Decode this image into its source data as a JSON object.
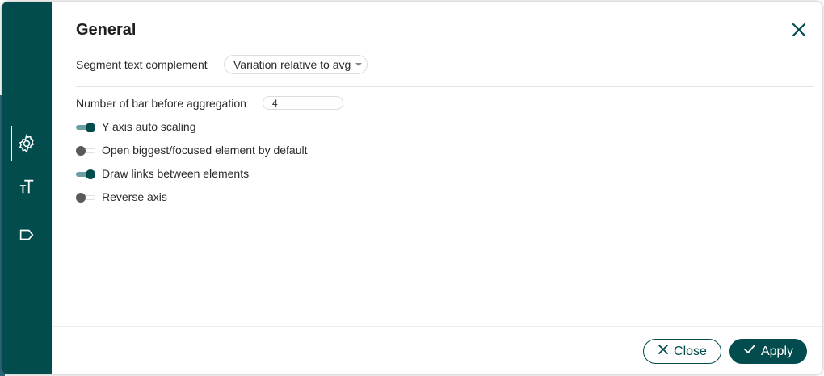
{
  "dialog": {
    "title": "General"
  },
  "sidebar": {
    "items": [
      {
        "icon": "gear-icon",
        "active": true
      },
      {
        "icon": "text-size-icon",
        "active": false
      },
      {
        "icon": "label-tag-icon",
        "active": false
      }
    ]
  },
  "settings": {
    "segment_text": {
      "label": "Segment text complement",
      "value": "Variation relative to avg"
    },
    "bar_aggregation": {
      "label": "Number of bar before aggregation",
      "value": "4"
    },
    "toggles": [
      {
        "label": "Y axis auto scaling",
        "on": true
      },
      {
        "label": "Open biggest/focused element by default",
        "on": false
      },
      {
        "label": "Draw links between elements",
        "on": true
      },
      {
        "label": "Reverse axis",
        "on": false
      }
    ]
  },
  "footer": {
    "close_label": "Close",
    "apply_label": "Apply"
  },
  "colors": {
    "accent": "#034c4e",
    "toggle_track_on": "#6b9ea2"
  }
}
